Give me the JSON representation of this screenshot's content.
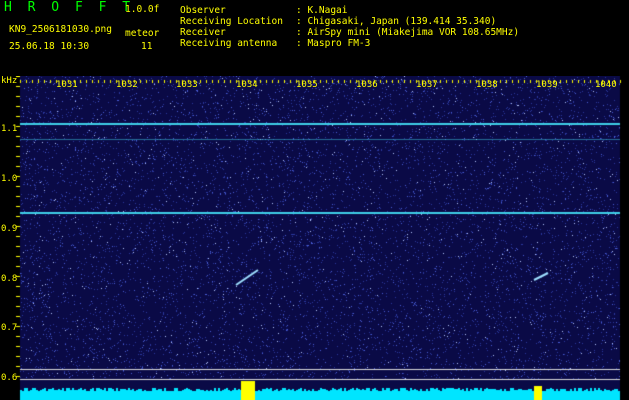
{
  "header": {
    "brand": "H R O F F T",
    "version": "1.0.0f",
    "filename": "KN9_2506181030.png",
    "meteor_label": "meteor",
    "datetime": "25.06.18 10:30",
    "meteor_count": "11",
    "fields": [
      {
        "label": "Observer",
        "value": ": K.Nagai"
      },
      {
        "label": "Receiving Location",
        "value": ": Chigasaki, Japan (139.414 35.340)"
      },
      {
        "label": "Receiver",
        "value": ": AirSpy mini (Miakejima VOR 108.65MHz)"
      },
      {
        "label": "Receiving antenna",
        "value": ": Maspro FM-3"
      }
    ]
  },
  "spectrogram": {
    "y_unit": "kHz",
    "y_ticks": [
      "1.1",
      "1.0",
      "0.9",
      "0.8",
      "0.7",
      "0.6"
    ],
    "x_ticks": [
      "1031",
      "1032",
      "1033",
      "1034",
      "1035",
      "1036",
      "1037",
      "1038",
      "1039",
      "1040"
    ],
    "colors": {
      "background": "#0a0a46",
      "line": "#3fd0e8",
      "baseline": "#00e5ff",
      "peak": "#ffff00"
    }
  }
}
